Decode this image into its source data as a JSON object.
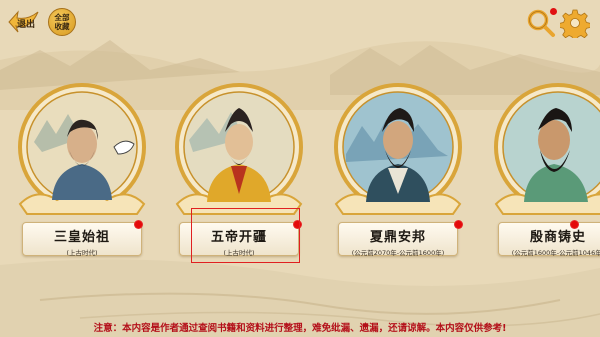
{
  "header": {
    "exit_label": "退出",
    "collection_label": "全部收藏",
    "search_icon": "search-icon",
    "settings_icon": "gear-icon",
    "search_badge_color": "#e01010"
  },
  "cards": [
    {
      "title": "三皇始祖",
      "era": "(上古时代)",
      "has_dot": true
    },
    {
      "title": "五帝开疆",
      "era": "(上古时代)",
      "has_dot": true,
      "selected": true
    },
    {
      "title": "夏鼎安邦",
      "era": "(公元前2070年-公元前1600年)",
      "has_dot": true
    },
    {
      "title": "殷商铸史",
      "era": "(公元前1600年-公元前1046年)",
      "has_dot": true
    }
  ],
  "footer": {
    "notice": "注意：本内容是作者通过查阅书籍和资料进行整理，难免纰漏、遗漏，还请谅解。本内容仅供参考!"
  },
  "colors": {
    "background": "#e7d8b7",
    "ring_gold": "#d9a53a",
    "notice_red": "#b4101a",
    "badge_red": "#e40a0a"
  }
}
